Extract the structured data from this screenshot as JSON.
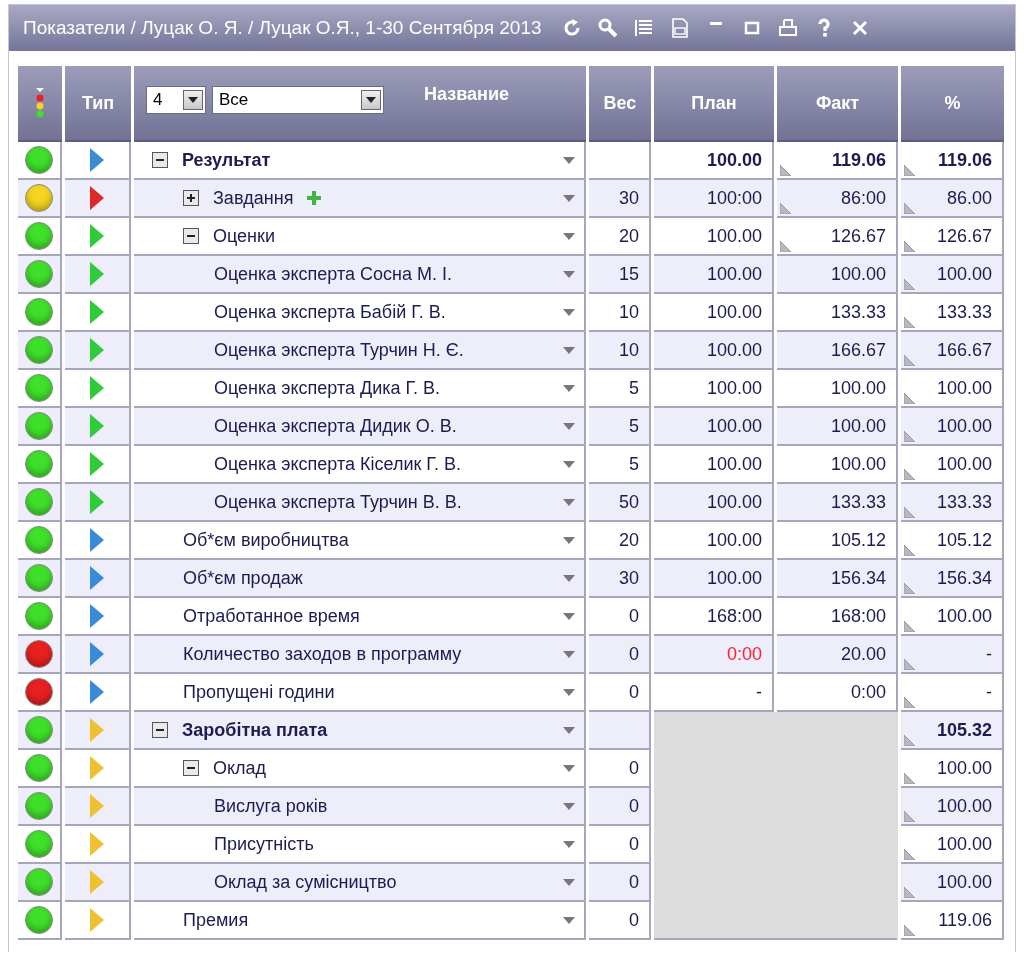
{
  "window": {
    "title": "Показатели / Луцак О. Я. / Луцак О.Я., 1-30 Сентября 2013"
  },
  "header": {
    "type": "Тип",
    "level_select": "4",
    "filter_select": "Все",
    "name": "Название",
    "weight": "Вес",
    "plan": "План",
    "fact": "Факт",
    "percent": "%"
  },
  "rows": [
    {
      "name": "Результат",
      "color": "#3fe02a",
      "type_icon": {
        "color": "#3a8ad8"
      },
      "plan": "100.00",
      "fact": "119.06",
      "percent": "119.06",
      "fact_marker": true,
      "plan_alert": false,
      "expanded": true,
      "children": [
        {
          "name": "Завдання",
          "color": "#f5d520",
          "type_icon": {
            "color": "#e02828"
          },
          "weight": "30",
          "plan": "100:00",
          "fact": "86:00",
          "percent": "86.00",
          "fact_marker": true,
          "plan_alert": false,
          "expanded": false,
          "addable": true
        },
        {
          "name": "Оценки",
          "color": "#3fe02a",
          "type_icon": {
            "color": "#2ecc3a"
          },
          "weight": "20",
          "plan": "100.00",
          "fact": "126.67",
          "percent": "126.67",
          "fact_marker": true,
          "plan_alert": false,
          "expanded": true,
          "children": [
            {
              "name": "Оценка эксперта Сосна М. І.",
              "color": "#3fe02a",
              "type_icon": {
                "color": "#2ecc3a"
              },
              "weight": "15",
              "plan": "100.00",
              "fact": "100.00",
              "percent": "100.00",
              "fact_marker": false,
              "plan_alert": false
            },
            {
              "name": "Оценка эксперта Бабій Г. В.",
              "color": "#3fe02a",
              "type_icon": {
                "color": "#2ecc3a"
              },
              "weight": "10",
              "plan": "100.00",
              "fact": "133.33",
              "percent": "133.33",
              "fact_marker": false,
              "plan_alert": false
            },
            {
              "name": "Оценка эксперта Турчин Н. Є.",
              "color": "#3fe02a",
              "type_icon": {
                "color": "#2ecc3a"
              },
              "weight": "10",
              "plan": "100.00",
              "fact": "166.67",
              "percent": "166.67",
              "fact_marker": false,
              "plan_alert": false
            },
            {
              "name": "Оценка эксперта Дика Г. В.",
              "color": "#3fe02a",
              "type_icon": {
                "color": "#2ecc3a"
              },
              "weight": "5",
              "plan": "100.00",
              "fact": "100.00",
              "percent": "100.00",
              "fact_marker": false,
              "plan_alert": false
            },
            {
              "name": "Оценка эксперта Дидик О. В.",
              "color": "#3fe02a",
              "type_icon": {
                "color": "#2ecc3a"
              },
              "weight": "5",
              "plan": "100.00",
              "fact": "100.00",
              "percent": "100.00",
              "fact_marker": false,
              "plan_alert": false
            },
            {
              "name": "Оценка эксперта Кіселик Г. В.",
              "color": "#3fe02a",
              "type_icon": {
                "color": "#2ecc3a"
              },
              "weight": "5",
              "plan": "100.00",
              "fact": "100.00",
              "percent": "100.00",
              "fact_marker": false,
              "plan_alert": false
            },
            {
              "name": "Оценка эксперта Турчин В. В.",
              "color": "#3fe02a",
              "type_icon": {
                "color": "#2ecc3a"
              },
              "weight": "50",
              "plan": "100.00",
              "fact": "133.33",
              "percent": "133.33",
              "fact_marker": false,
              "plan_alert": false
            }
          ]
        },
        {
          "name": "Об*єм виробництва",
          "color": "#3fe02a",
          "type_icon": {
            "color": "#3a8ad8"
          },
          "weight": "20",
          "plan": "100.00",
          "fact": "105.12",
          "percent": "105.12",
          "fact_marker": false,
          "plan_alert": false
        },
        {
          "name": "Об*єм продаж",
          "color": "#3fe02a",
          "type_icon": {
            "color": "#3a8ad8"
          },
          "weight": "30",
          "plan": "100.00",
          "fact": "156.34",
          "percent": "156.34",
          "fact_marker": false,
          "plan_alert": false
        },
        {
          "name": "Отработанное время",
          "color": "#3fe02a",
          "type_icon": {
            "color": "#3a8ad8"
          },
          "weight": "0",
          "plan": "168:00",
          "fact": "168:00",
          "percent": "100.00",
          "fact_marker": false,
          "plan_alert": false
        },
        {
          "name": "Количество заходов в программу",
          "color": "#e82020",
          "type_icon": {
            "color": "#3a8ad8"
          },
          "weight": "0",
          "plan": "0:00",
          "fact": "20.00",
          "percent": "-",
          "fact_marker": false,
          "plan_alert": true
        },
        {
          "name": "Пропущені години",
          "color": "#e82020",
          "type_icon": {
            "color": "#3a8ad8"
          },
          "weight": "0",
          "plan": "-",
          "fact": "0:00",
          "percent": "-",
          "fact_marker": false,
          "plan_alert": false
        }
      ]
    },
    {
      "name": "Заробітна плата",
      "color": "#3fe02a",
      "type_icon": {
        "color": "#f0c030"
      },
      "percent": "105.32",
      "expanded": true,
      "children": [
        {
          "name": "Оклад",
          "color": "#3fe02a",
          "type_icon": {
            "color": "#f0c030"
          },
          "weight": "0",
          "percent": "100.00",
          "expanded": true,
          "children": [
            {
              "name": "Вислуга років",
              "color": "#3fe02a",
              "type_icon": {
                "color": "#f0c030"
              },
              "weight": "0",
              "percent": "100.00"
            },
            {
              "name": "Присутність",
              "color": "#3fe02a",
              "type_icon": {
                "color": "#f0c030"
              },
              "weight": "0",
              "percent": "100.00"
            },
            {
              "name": "Оклад за сумісництво",
              "color": "#3fe02a",
              "type_icon": {
                "color": "#f0c030"
              },
              "weight": "0",
              "percent": "100.00"
            }
          ]
        },
        {
          "name": "Премия",
          "color": "#3fe02a",
          "type_icon": {
            "color": "#f0c030"
          },
          "weight": "0",
          "percent": "119.06"
        }
      ]
    }
  ]
}
